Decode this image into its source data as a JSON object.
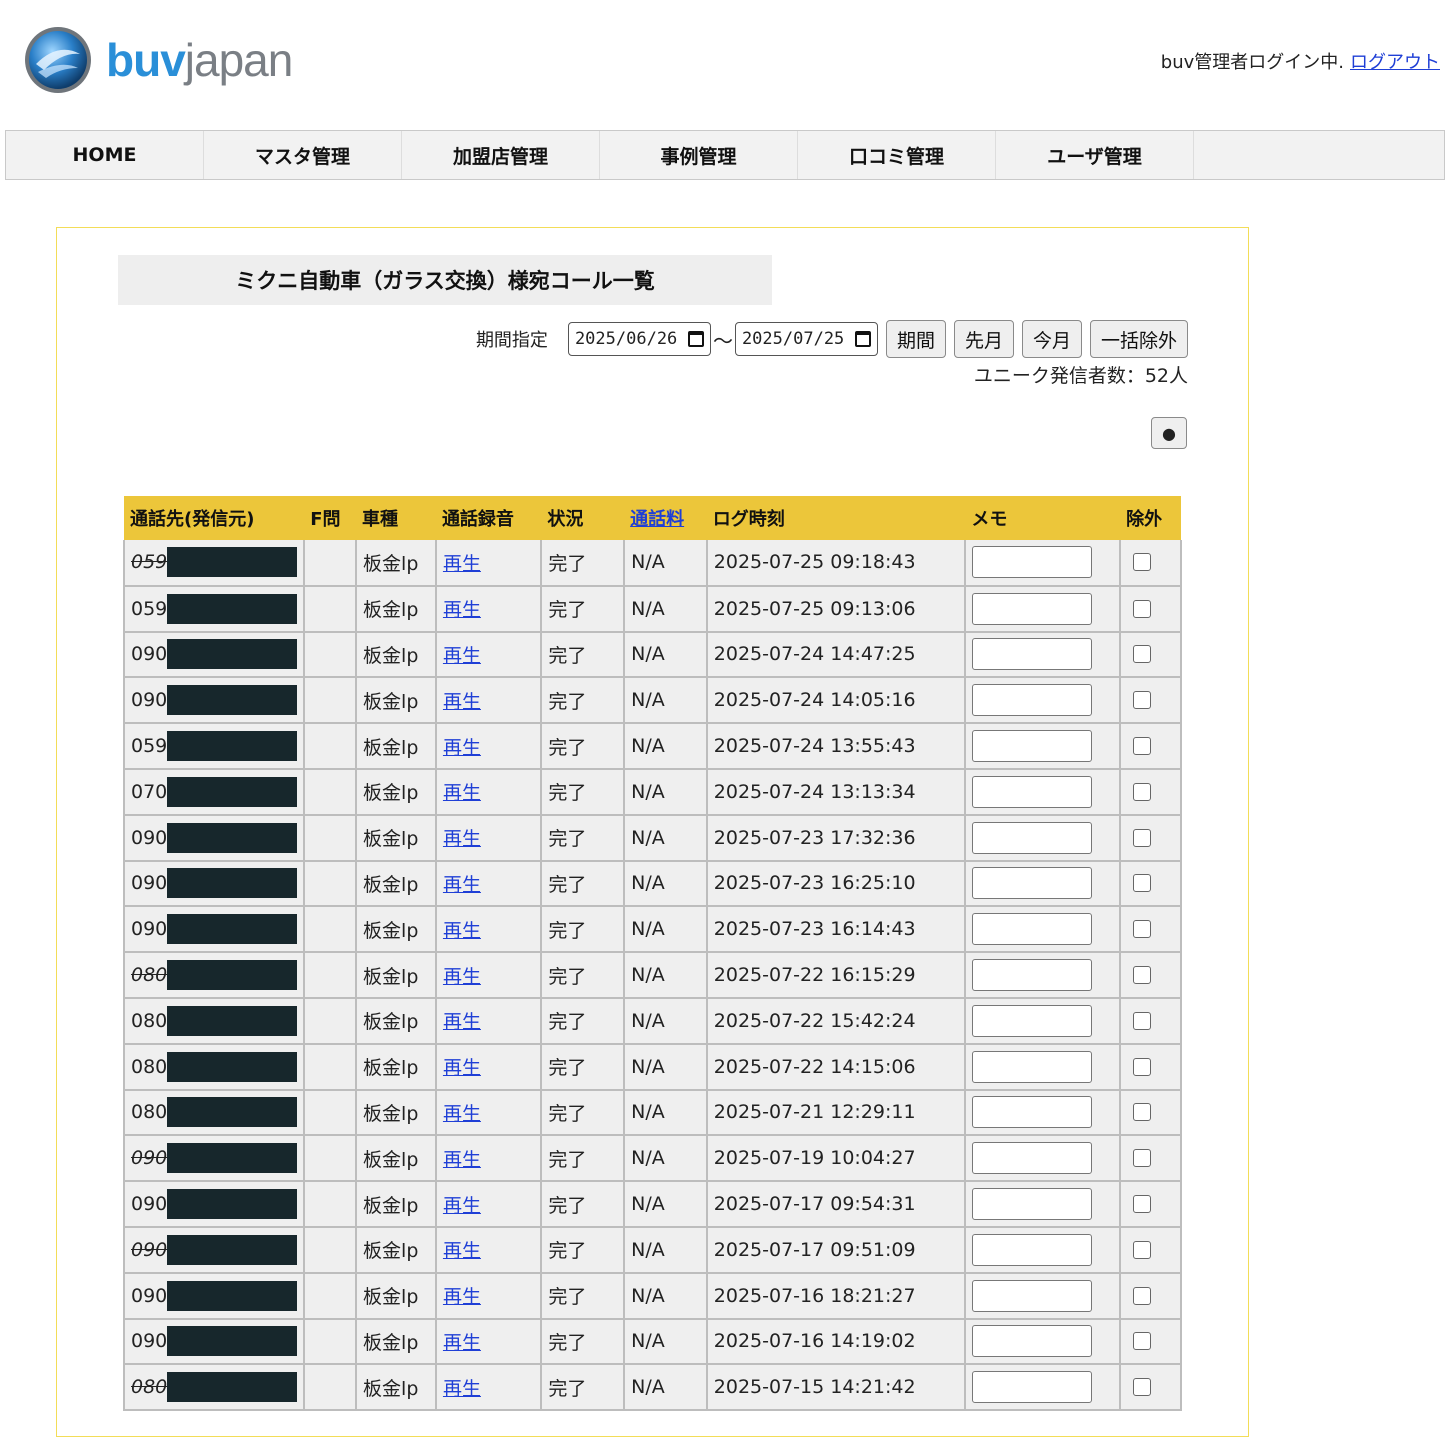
{
  "header": {
    "logo_primary": "buv",
    "logo_secondary": "japan",
    "login_status": "buv管理者ログイン中.",
    "logout_label": "ログアウト"
  },
  "nav": {
    "items": [
      "HOME",
      "マスタ管理",
      "加盟店管理",
      "事例管理",
      "口コミ管理",
      "ユーザ管理"
    ]
  },
  "page": {
    "title": "ミクニ自動車（ガラス交換）様宛コール一覧",
    "period_label": "期間指定",
    "date_from": "2025/06/26",
    "date_to": "2025/07/25",
    "tilde": "〜",
    "btn_period": "期間",
    "btn_prev_month": "先月",
    "btn_this_month": "今月",
    "btn_bulk_exclude": "一括除外",
    "unique_callers": "ユニーク発信者数：52人",
    "dot_button": "●"
  },
  "table": {
    "headers": [
      "通話先(発信元)",
      "F問",
      "車種",
      "通話録音",
      "状況",
      "通話料",
      "ログ時刻",
      "メモ",
      "除外"
    ],
    "rows": [
      {
        "prefix": "059",
        "strike": true,
        "fq": "",
        "car": "板金lp",
        "rec": "再生",
        "status": "完了",
        "fee": "N/A",
        "time": "2025-07-25 09:18:43"
      },
      {
        "prefix": "059",
        "strike": false,
        "fq": "",
        "car": "板金lp",
        "rec": "再生",
        "status": "完了",
        "fee": "N/A",
        "time": "2025-07-25 09:13:06"
      },
      {
        "prefix": "090",
        "strike": false,
        "fq": "",
        "car": "板金lp",
        "rec": "再生",
        "status": "完了",
        "fee": "N/A",
        "time": "2025-07-24 14:47:25"
      },
      {
        "prefix": "090",
        "strike": false,
        "fq": "",
        "car": "板金lp",
        "rec": "再生",
        "status": "完了",
        "fee": "N/A",
        "time": "2025-07-24 14:05:16"
      },
      {
        "prefix": "059",
        "strike": false,
        "fq": "",
        "car": "板金lp",
        "rec": "再生",
        "status": "完了",
        "fee": "N/A",
        "time": "2025-07-24 13:55:43"
      },
      {
        "prefix": "070",
        "strike": false,
        "fq": "",
        "car": "板金lp",
        "rec": "再生",
        "status": "完了",
        "fee": "N/A",
        "time": "2025-07-24 13:13:34"
      },
      {
        "prefix": "090",
        "strike": false,
        "fq": "",
        "car": "板金lp",
        "rec": "再生",
        "status": "完了",
        "fee": "N/A",
        "time": "2025-07-23 17:32:36"
      },
      {
        "prefix": "090",
        "strike": false,
        "fq": "",
        "car": "板金lp",
        "rec": "再生",
        "status": "完了",
        "fee": "N/A",
        "time": "2025-07-23 16:25:10"
      },
      {
        "prefix": "090",
        "strike": false,
        "fq": "",
        "car": "板金lp",
        "rec": "再生",
        "status": "完了",
        "fee": "N/A",
        "time": "2025-07-23 16:14:43"
      },
      {
        "prefix": "080",
        "strike": true,
        "fq": "",
        "car": "板金lp",
        "rec": "再生",
        "status": "完了",
        "fee": "N/A",
        "time": "2025-07-22 16:15:29"
      },
      {
        "prefix": "080",
        "strike": false,
        "fq": "",
        "car": "板金lp",
        "rec": "再生",
        "status": "完了",
        "fee": "N/A",
        "time": "2025-07-22 15:42:24"
      },
      {
        "prefix": "080",
        "strike": false,
        "fq": "",
        "car": "板金lp",
        "rec": "再生",
        "status": "完了",
        "fee": "N/A",
        "time": "2025-07-22 14:15:06"
      },
      {
        "prefix": "080",
        "strike": false,
        "fq": "",
        "car": "板金lp",
        "rec": "再生",
        "status": "完了",
        "fee": "N/A",
        "time": "2025-07-21 12:29:11"
      },
      {
        "prefix": "090",
        "strike": true,
        "fq": "",
        "car": "板金lp",
        "rec": "再生",
        "status": "完了",
        "fee": "N/A",
        "time": "2025-07-19 10:04:27"
      },
      {
        "prefix": "090",
        "strike": false,
        "fq": "",
        "car": "板金lp",
        "rec": "再生",
        "status": "完了",
        "fee": "N/A",
        "time": "2025-07-17 09:54:31"
      },
      {
        "prefix": "090",
        "strike": true,
        "fq": "",
        "car": "板金lp",
        "rec": "再生",
        "status": "完了",
        "fee": "N/A",
        "time": "2025-07-17 09:51:09"
      },
      {
        "prefix": "090",
        "strike": false,
        "fq": "",
        "car": "板金lp",
        "rec": "再生",
        "status": "完了",
        "fee": "N/A",
        "time": "2025-07-16 18:21:27"
      },
      {
        "prefix": "090",
        "strike": false,
        "fq": "",
        "car": "板金lp",
        "rec": "再生",
        "status": "完了",
        "fee": "N/A",
        "time": "2025-07-16 14:19:02"
      },
      {
        "prefix": "080",
        "strike": true,
        "fq": "",
        "car": "板金lp",
        "rec": "再生",
        "status": "完了",
        "fee": "N/A",
        "time": "2025-07-15 14:21:42"
      }
    ]
  },
  "colors": {
    "header_bg": "#ecc63a",
    "panel_border": "#f3dd58",
    "link": "#1f3fd6",
    "mask": "#17272c",
    "logo_blue": "#2a8fd8"
  }
}
